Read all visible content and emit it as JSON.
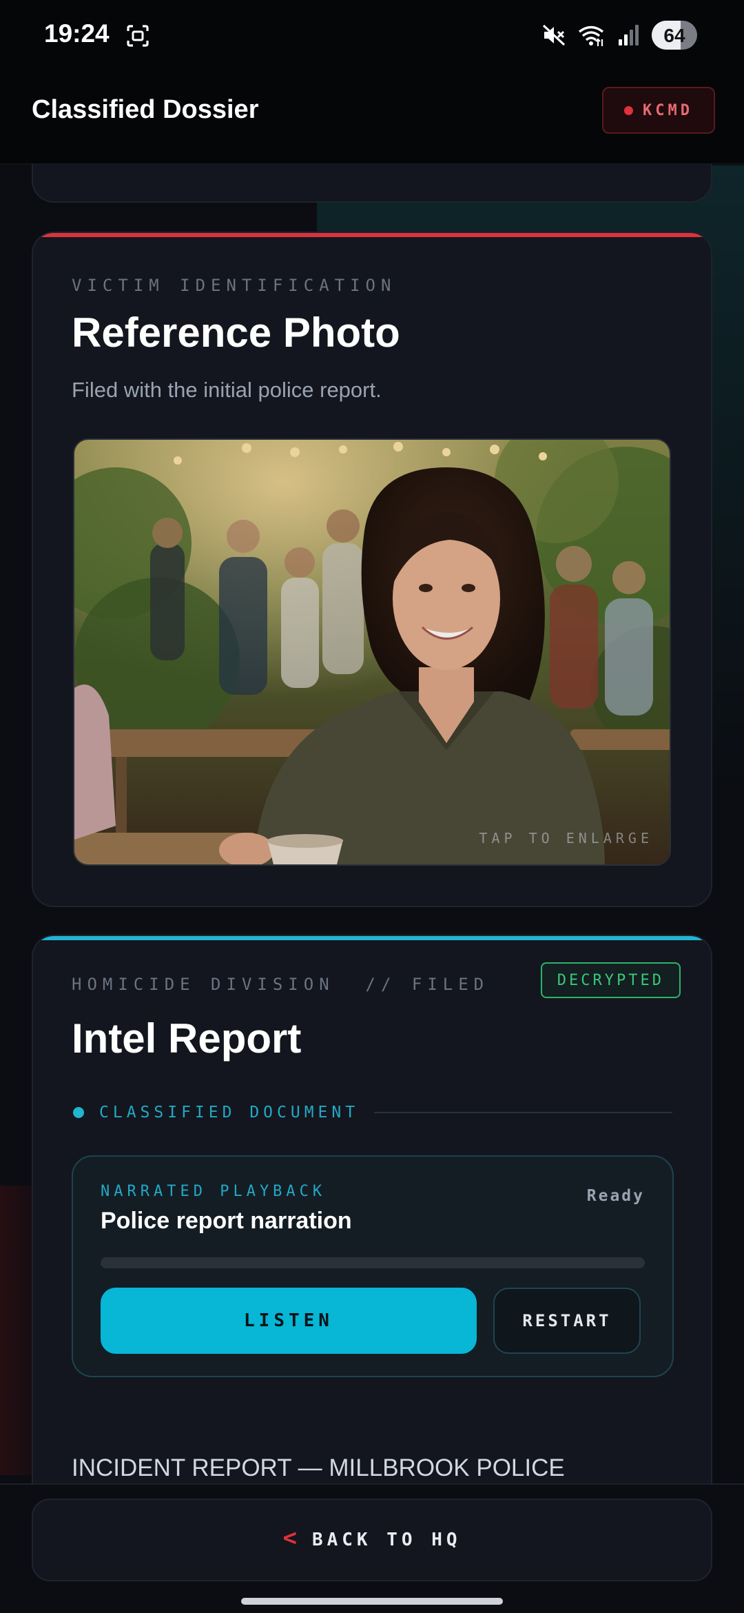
{
  "status_bar": {
    "time": "19:24",
    "battery": "64",
    "battery_level": 0.64,
    "icons": [
      "screenshot-icon",
      "mute-icon",
      "wifi-icon",
      "signal-icon",
      "battery-icon"
    ]
  },
  "header": {
    "title": "Classified Dossier",
    "badge": "KCMD",
    "badge_color": "#e0313c"
  },
  "photo_card": {
    "eyebrow": "VICTIM IDENTIFICATION",
    "title": "Reference Photo",
    "subtitle": "Filed with the initial police report.",
    "tap_hint": "TAP TO ENLARGE",
    "accent": "#d9343d"
  },
  "intel_card": {
    "eyebrow": "HOMICIDE DIVISION  // FILED",
    "badge": "DECRYPTED",
    "title": "Intel Report",
    "classification": "CLASSIFIED DOCUMENT",
    "accent": "#22b4d1",
    "player": {
      "eyebrow": "NARRATED PLAYBACK",
      "title": "Police report narration",
      "status": "Ready",
      "progress": 0,
      "listen_label": "LISTEN",
      "restart_label": "RESTART"
    },
    "body_heading": "INCIDENT REPORT — MILLBROOK POLICE"
  },
  "bottom_nav": {
    "chevron": "<",
    "back_label": "BACK TO HQ"
  }
}
